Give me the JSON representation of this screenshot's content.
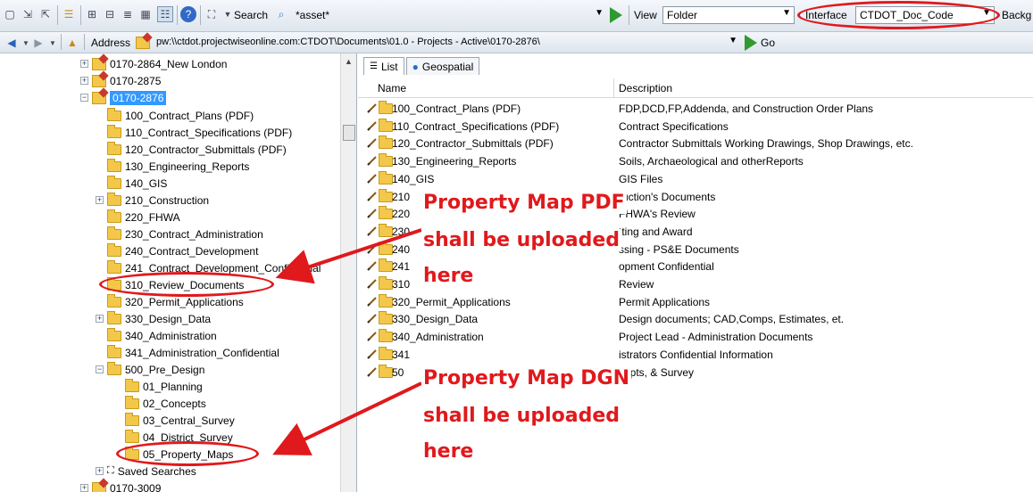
{
  "toolbar": {
    "search_label": "Search",
    "search_value": "*asset*",
    "view_label": "View",
    "view_value": "Folder",
    "interface_label": "Interface",
    "interface_value": "CTDOT_Doc_Code",
    "background_label": "Backg"
  },
  "address_bar": {
    "label": "Address",
    "value": "pw:\\\\ctdot.projectwiseonline.com:CTDOT\\Documents\\01.0 - Projects - Active\\0170-2876\\",
    "go_label": "Go"
  },
  "tree": {
    "items": [
      {
        "label": "0170-2864_New London",
        "kind": "project",
        "expander": "+"
      },
      {
        "label": "0170-2875",
        "kind": "project",
        "expander": "+"
      },
      {
        "label": "0170-2876",
        "kind": "project",
        "expander": "-",
        "selected": true
      },
      {
        "label": "100_Contract_Plans (PDF)",
        "kind": "folder"
      },
      {
        "label": "110_Contract_Specifications (PDF)",
        "kind": "folder"
      },
      {
        "label": "120_Contractor_Submittals (PDF)",
        "kind": "folder"
      },
      {
        "label": "130_Engineering_Reports",
        "kind": "folder"
      },
      {
        "label": "140_GIS",
        "kind": "folder"
      },
      {
        "label": "210_Construction",
        "kind": "folder",
        "expander": "+"
      },
      {
        "label": "220_FHWA",
        "kind": "folder"
      },
      {
        "label": "230_Contract_Administration",
        "kind": "folder"
      },
      {
        "label": "240_Contract_Development",
        "kind": "folder"
      },
      {
        "label": "241_Contract_Development_Confidential",
        "kind": "folder"
      },
      {
        "label": "310_Review_Documents",
        "kind": "folder"
      },
      {
        "label": "320_Permit_Applications",
        "kind": "folder"
      },
      {
        "label": "330_Design_Data",
        "kind": "folder",
        "expander": "+"
      },
      {
        "label": "340_Administration",
        "kind": "folder"
      },
      {
        "label": "341_Administration_Confidential",
        "kind": "folder"
      },
      {
        "label": "500_Pre_Design",
        "kind": "folder",
        "expander": "-"
      },
      {
        "label": "01_Planning",
        "kind": "folder"
      },
      {
        "label": "02_Concepts",
        "kind": "folder"
      },
      {
        "label": "03_Central_Survey",
        "kind": "folder"
      },
      {
        "label": "04_District_Survey",
        "kind": "folder"
      },
      {
        "label": "05_Property_Maps",
        "kind": "folder"
      },
      {
        "label": "Saved Searches",
        "kind": "search",
        "expander": "+"
      },
      {
        "label": "0170-3009",
        "kind": "project",
        "expander": "+"
      }
    ]
  },
  "tabs": [
    {
      "label": "List"
    },
    {
      "label": "Geospatial"
    }
  ],
  "grid": {
    "headers": {
      "name": "Name",
      "description": "Description"
    },
    "rows": [
      {
        "name": "100_Contract_Plans (PDF)",
        "description": "FDP,DCD,FP,Addenda, and Construction Order Plans"
      },
      {
        "name": "110_Contract_Specifications (PDF)",
        "description": "Contract Specifications"
      },
      {
        "name": "120_Contractor_Submittals (PDF)",
        "description": "Contractor Submittals Working Drawings, Shop Drawings, etc."
      },
      {
        "name": "130_Engineering_Reports",
        "description": "Soils, Archaeological and otherReports"
      },
      {
        "name": "140_GIS",
        "description": "GIS Files"
      },
      {
        "name": "210",
        "description": "ruction's Documents"
      },
      {
        "name": "220",
        "description": "FHWA's Review"
      },
      {
        "name": "230",
        "description": "tting and Award"
      },
      {
        "name": "240",
        "description": "ssing - PS&E Documents"
      },
      {
        "name": "241",
        "description": "opment Confidential"
      },
      {
        "name": "310",
        "description": "Review"
      },
      {
        "name": "320_Permit_Applications",
        "description": "Permit Applications"
      },
      {
        "name": "330_Design_Data",
        "description": "Design documents; CAD,Comps, Estimates, et."
      },
      {
        "name": "340_Administration",
        "description": "Project Lead -  Administration Documents"
      },
      {
        "name": "341",
        "description": "istrators Confidential Information"
      },
      {
        "name": "50",
        "description": "cepts, & Survey"
      }
    ]
  },
  "annotations": {
    "pdf_line1": "Property Map PDF",
    "pdf_line2": "shall be uploaded",
    "pdf_line3": "here",
    "dgn_line1": "Property Map DGN",
    "dgn_line2": "shall be uploaded",
    "dgn_line3": "here",
    "color": "#e0191c"
  }
}
